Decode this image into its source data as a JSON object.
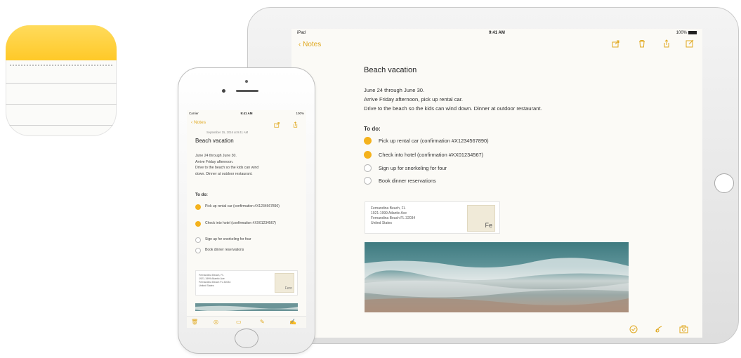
{
  "colors": {
    "accent": "#e0a81f",
    "check_done": "#f4b21d",
    "icon_top": "#ffcf33"
  },
  "ipad": {
    "status": {
      "carrier": "iPad",
      "time": "9:41 AM",
      "battery": "100%"
    },
    "back_label": "Notes",
    "toolbar_top_icons": [
      "share-icon",
      "trash-icon",
      "export-icon",
      "compose-icon"
    ],
    "note": {
      "title": "Beach vacation",
      "body_lines": [
        "June 24 through June 30.",
        "Arrive Friday afternoon, pick up rental car.",
        "Drive to the beach so the kids can wind down. Dinner at outdoor restaurant."
      ],
      "todo_heading": "To do:",
      "todos": [
        {
          "text": "Pick up rental car (confirmation #X1234567890)",
          "done": true
        },
        {
          "text": "Check into hotel (confirmation #XX01234567)",
          "done": true
        },
        {
          "text": "Sign up for snorkeling for four",
          "done": false
        },
        {
          "text": "Book dinner reservations",
          "done": false
        }
      ],
      "map_card": {
        "lines": [
          "Fernandina Beach, FL",
          "1921-1999 Atlantic Ave",
          "Fernandina Beach FL 32034",
          "United States"
        ],
        "thumb_label": "Fe"
      }
    },
    "toolbar_bottom_icons": [
      "checklist-icon",
      "sketch-icon",
      "camera-icon"
    ]
  },
  "iphone": {
    "status": {
      "carrier": "Carrier",
      "time": "9:41 AM",
      "battery": "100%"
    },
    "back_label": "Notes",
    "date_line": "September 15, 2016 at 9:41 AM",
    "note": {
      "title": "Beach vacation",
      "body_lines": [
        "June 24 through June 30.",
        "Arrive Friday afternoon.",
        "Drive to the beach so the kids can wind",
        "down. Dinner at outdoor restaurant."
      ],
      "todo_heading": "To do:",
      "todos": [
        {
          "text": "Pick up rental car (confirmation #X1234567890)",
          "done": true
        },
        {
          "text": "Check into hotel (confirmation #XX01234567)",
          "done": true
        },
        {
          "text": "Sign up for snorkeling for four",
          "done": false
        },
        {
          "text": "Book dinner reservations",
          "done": false
        }
      ],
      "map_card": {
        "lines": [
          "Fernandina Beach, FL",
          "1921-1999 Atlantic Ave",
          "Fernandina Beach FL 32034",
          "United States"
        ],
        "thumb_label": "Fern"
      }
    },
    "toolbar_icons": [
      "trash-icon",
      "checklist-icon",
      "camera-icon",
      "sketch-icon",
      "compose-icon"
    ]
  }
}
